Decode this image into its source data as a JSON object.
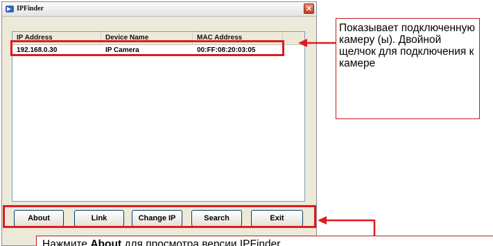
{
  "window": {
    "title": "IPFinder",
    "close_glyph": "✕"
  },
  "list": {
    "columns": [
      "IP Address",
      "Device Name",
      "MAC Address"
    ],
    "rows": [
      {
        "ip": "192.168.0.30",
        "name": "IP Camera",
        "mac": "00:FF:08:20:03:05"
      }
    ]
  },
  "buttons": {
    "about": "About",
    "link": "Link",
    "change_ip": "Change IP",
    "search": "Search",
    "exit": "Exit"
  },
  "annotations": {
    "list_note": "Показывает подключенную камеру (ы). Двойной щелчок для подключения к камере",
    "buttons_note_bold": "About",
    "buttons_note_prefix": "Нажмите",
    "buttons_note_suffix": "для просмотра версии IPFinder"
  },
  "colors": {
    "highlight": "#e0191c",
    "window_bg": "#ece9d8"
  },
  "icons": {
    "app": "camera-app-icon",
    "close": "close-icon"
  }
}
